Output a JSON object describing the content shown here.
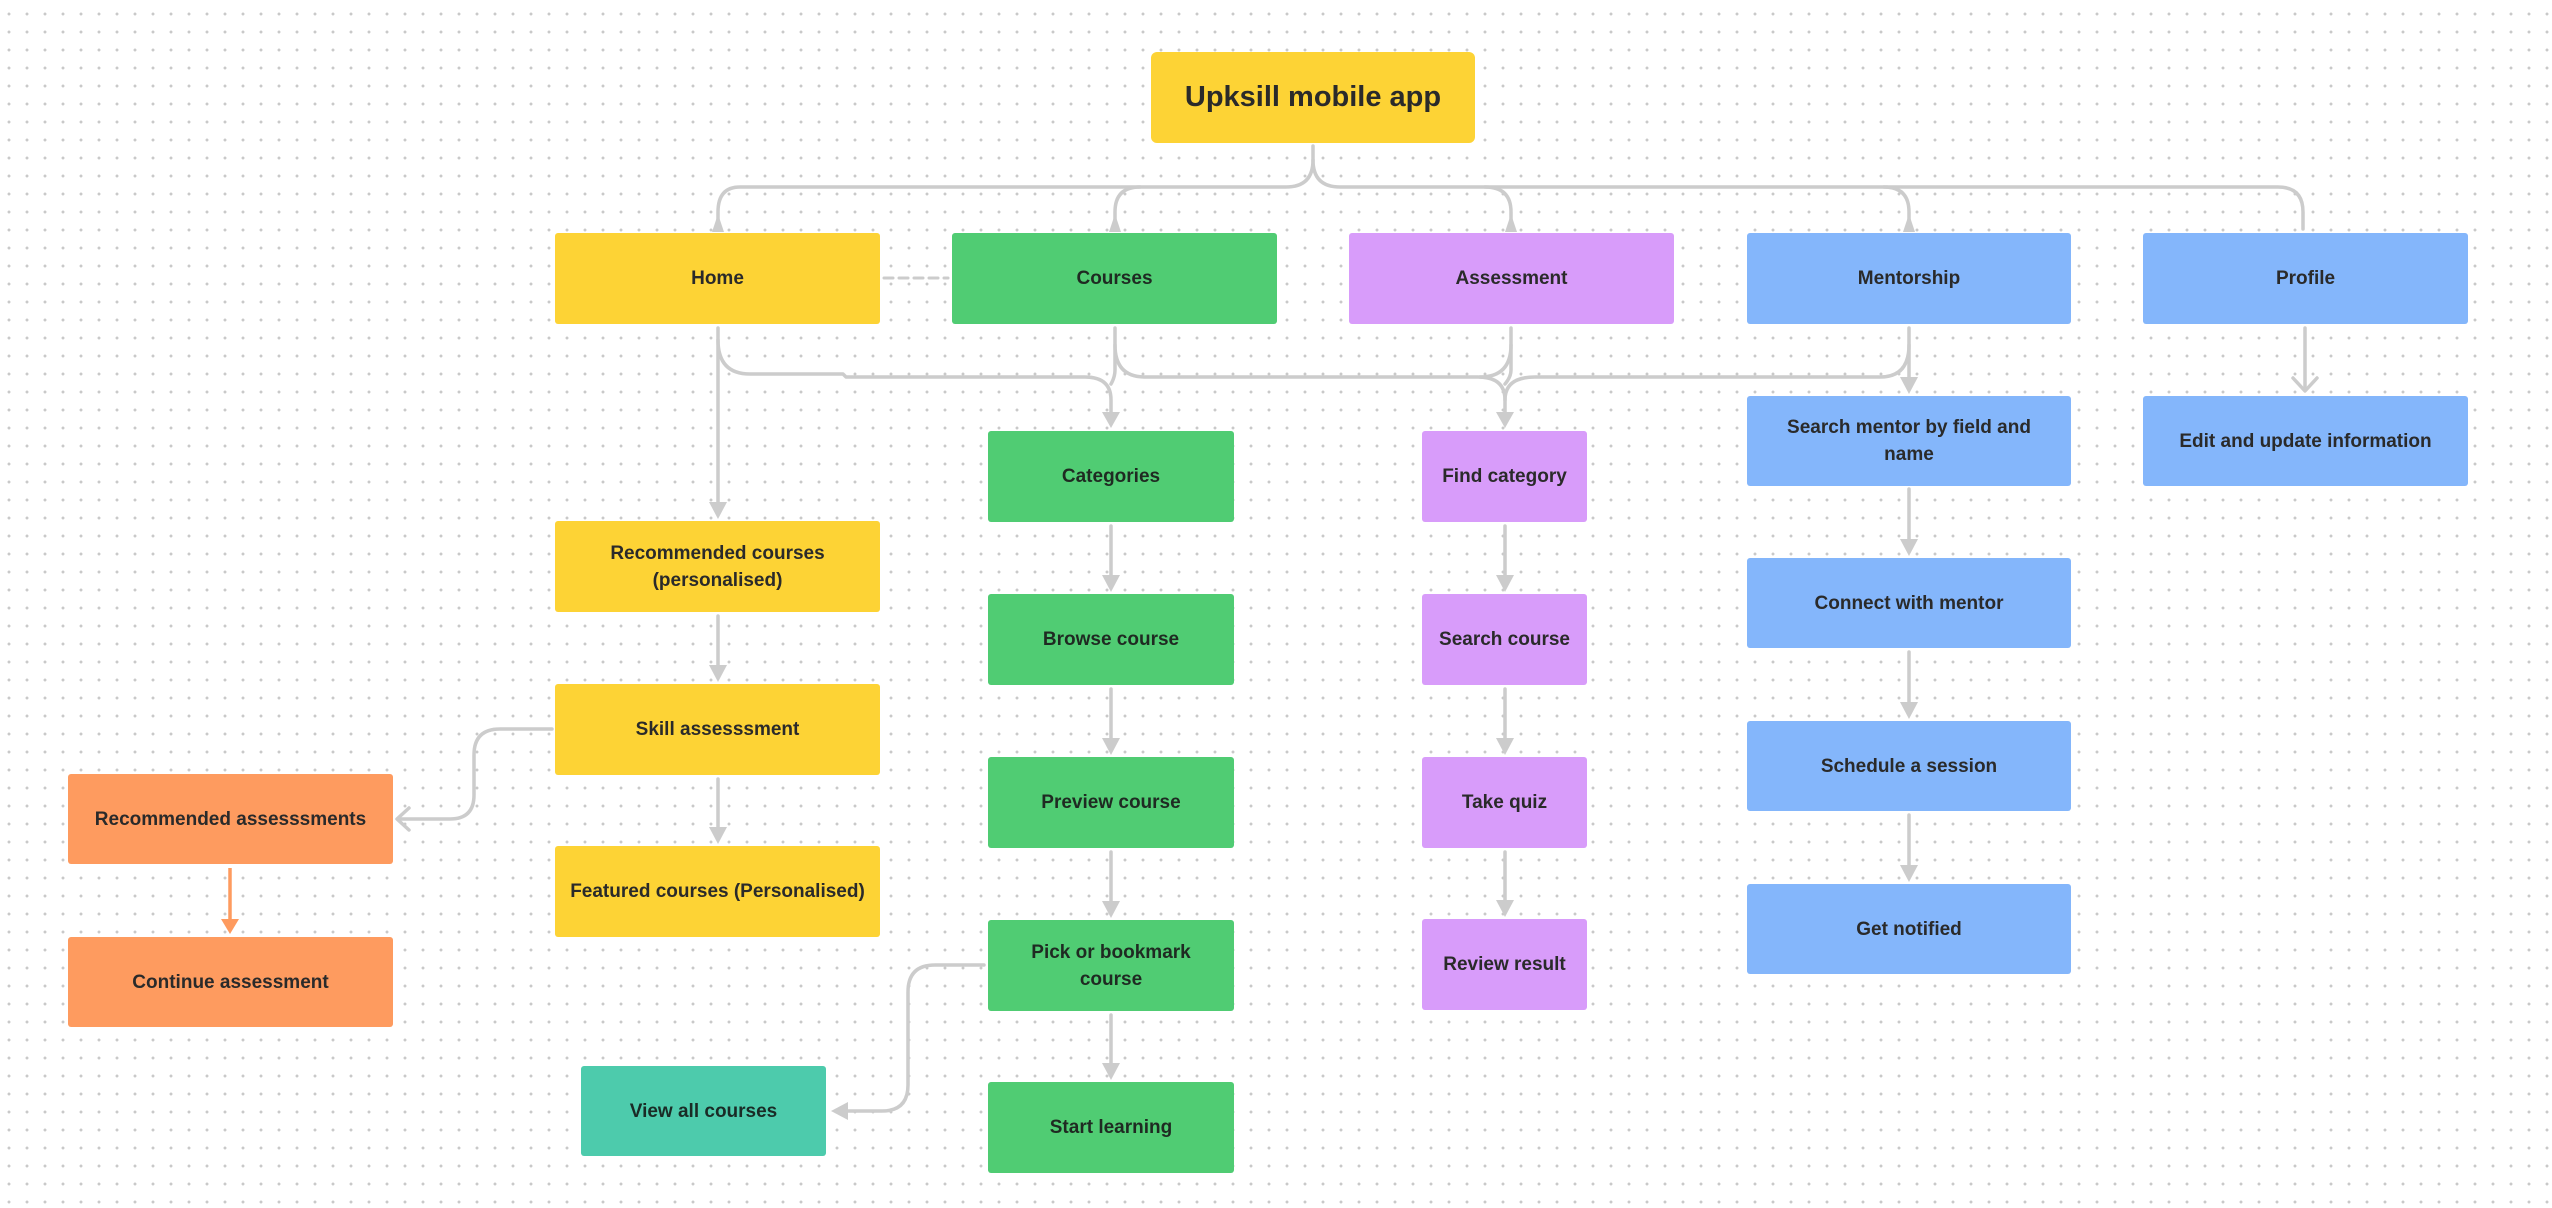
{
  "diagram": {
    "title": "Upksill mobile app",
    "colors": {
      "yellow": "#fdd335",
      "green": "#50cc73",
      "purple": "#d89cfa",
      "blue": "#84b6fb",
      "orange": "#fe9b5f",
      "teal": "#4dcbac",
      "connector": "#cccccc",
      "connector_orange": "#fe9b5f"
    },
    "sections": [
      {
        "id": "home",
        "label": "Home",
        "color": "yellow",
        "steps": [
          "Recommended courses (personalised)",
          "Skill assesssment",
          "Featured courses (Personalised)"
        ],
        "branch": {
          "from": "Skill assesssment",
          "steps": [
            "Recommended assesssments",
            "Continue assessment"
          ],
          "color": "orange"
        }
      },
      {
        "id": "courses",
        "label": "Courses",
        "color": "green",
        "steps": [
          "Categories",
          "Browse course",
          "Preview course",
          "Pick or bookmark course",
          "Start learning"
        ],
        "branch": {
          "from": "Pick or bookmark course",
          "steps": [
            "View all courses"
          ],
          "color": "teal"
        }
      },
      {
        "id": "assessment",
        "label": "Assessment",
        "color": "purple",
        "steps": [
          "Find category",
          "Search course",
          "Take quiz",
          "Review result"
        ]
      },
      {
        "id": "mentorship",
        "label": "Mentorship",
        "color": "blue",
        "steps": [
          "Search mentor by field and name",
          "Connect with mentor",
          "Schedule a session",
          "Get notified"
        ]
      },
      {
        "id": "profile",
        "label": "Profile",
        "color": "blue",
        "steps": [
          "Edit and update information"
        ]
      }
    ],
    "edges": [
      {
        "from": "Upksill mobile app",
        "to": "Home",
        "style": "solid"
      },
      {
        "from": "Upksill mobile app",
        "to": "Courses",
        "style": "solid"
      },
      {
        "from": "Upksill mobile app",
        "to": "Assessment",
        "style": "solid"
      },
      {
        "from": "Upksill mobile app",
        "to": "Mentorship",
        "style": "solid"
      },
      {
        "from": "Upksill mobile app",
        "to": "Profile",
        "style": "solid"
      },
      {
        "from": "Home",
        "to": "Courses",
        "style": "dashed"
      },
      {
        "from": "Home",
        "to": "Categories",
        "style": "solid"
      },
      {
        "from": "Courses",
        "to": "Categories",
        "style": "solid"
      },
      {
        "from": "Courses",
        "to": "Find category",
        "style": "solid"
      },
      {
        "from": "Assessment",
        "to": "Categories",
        "style": "solid"
      },
      {
        "from": "Assessment",
        "to": "Find category",
        "style": "solid"
      },
      {
        "from": "Mentorship",
        "to": "Find category",
        "style": "solid"
      },
      {
        "from": "Mentorship",
        "to": "Search mentor by field and name",
        "style": "solid"
      },
      {
        "from": "Profile",
        "to": "Edit and update information",
        "style": "solid"
      }
    ]
  }
}
